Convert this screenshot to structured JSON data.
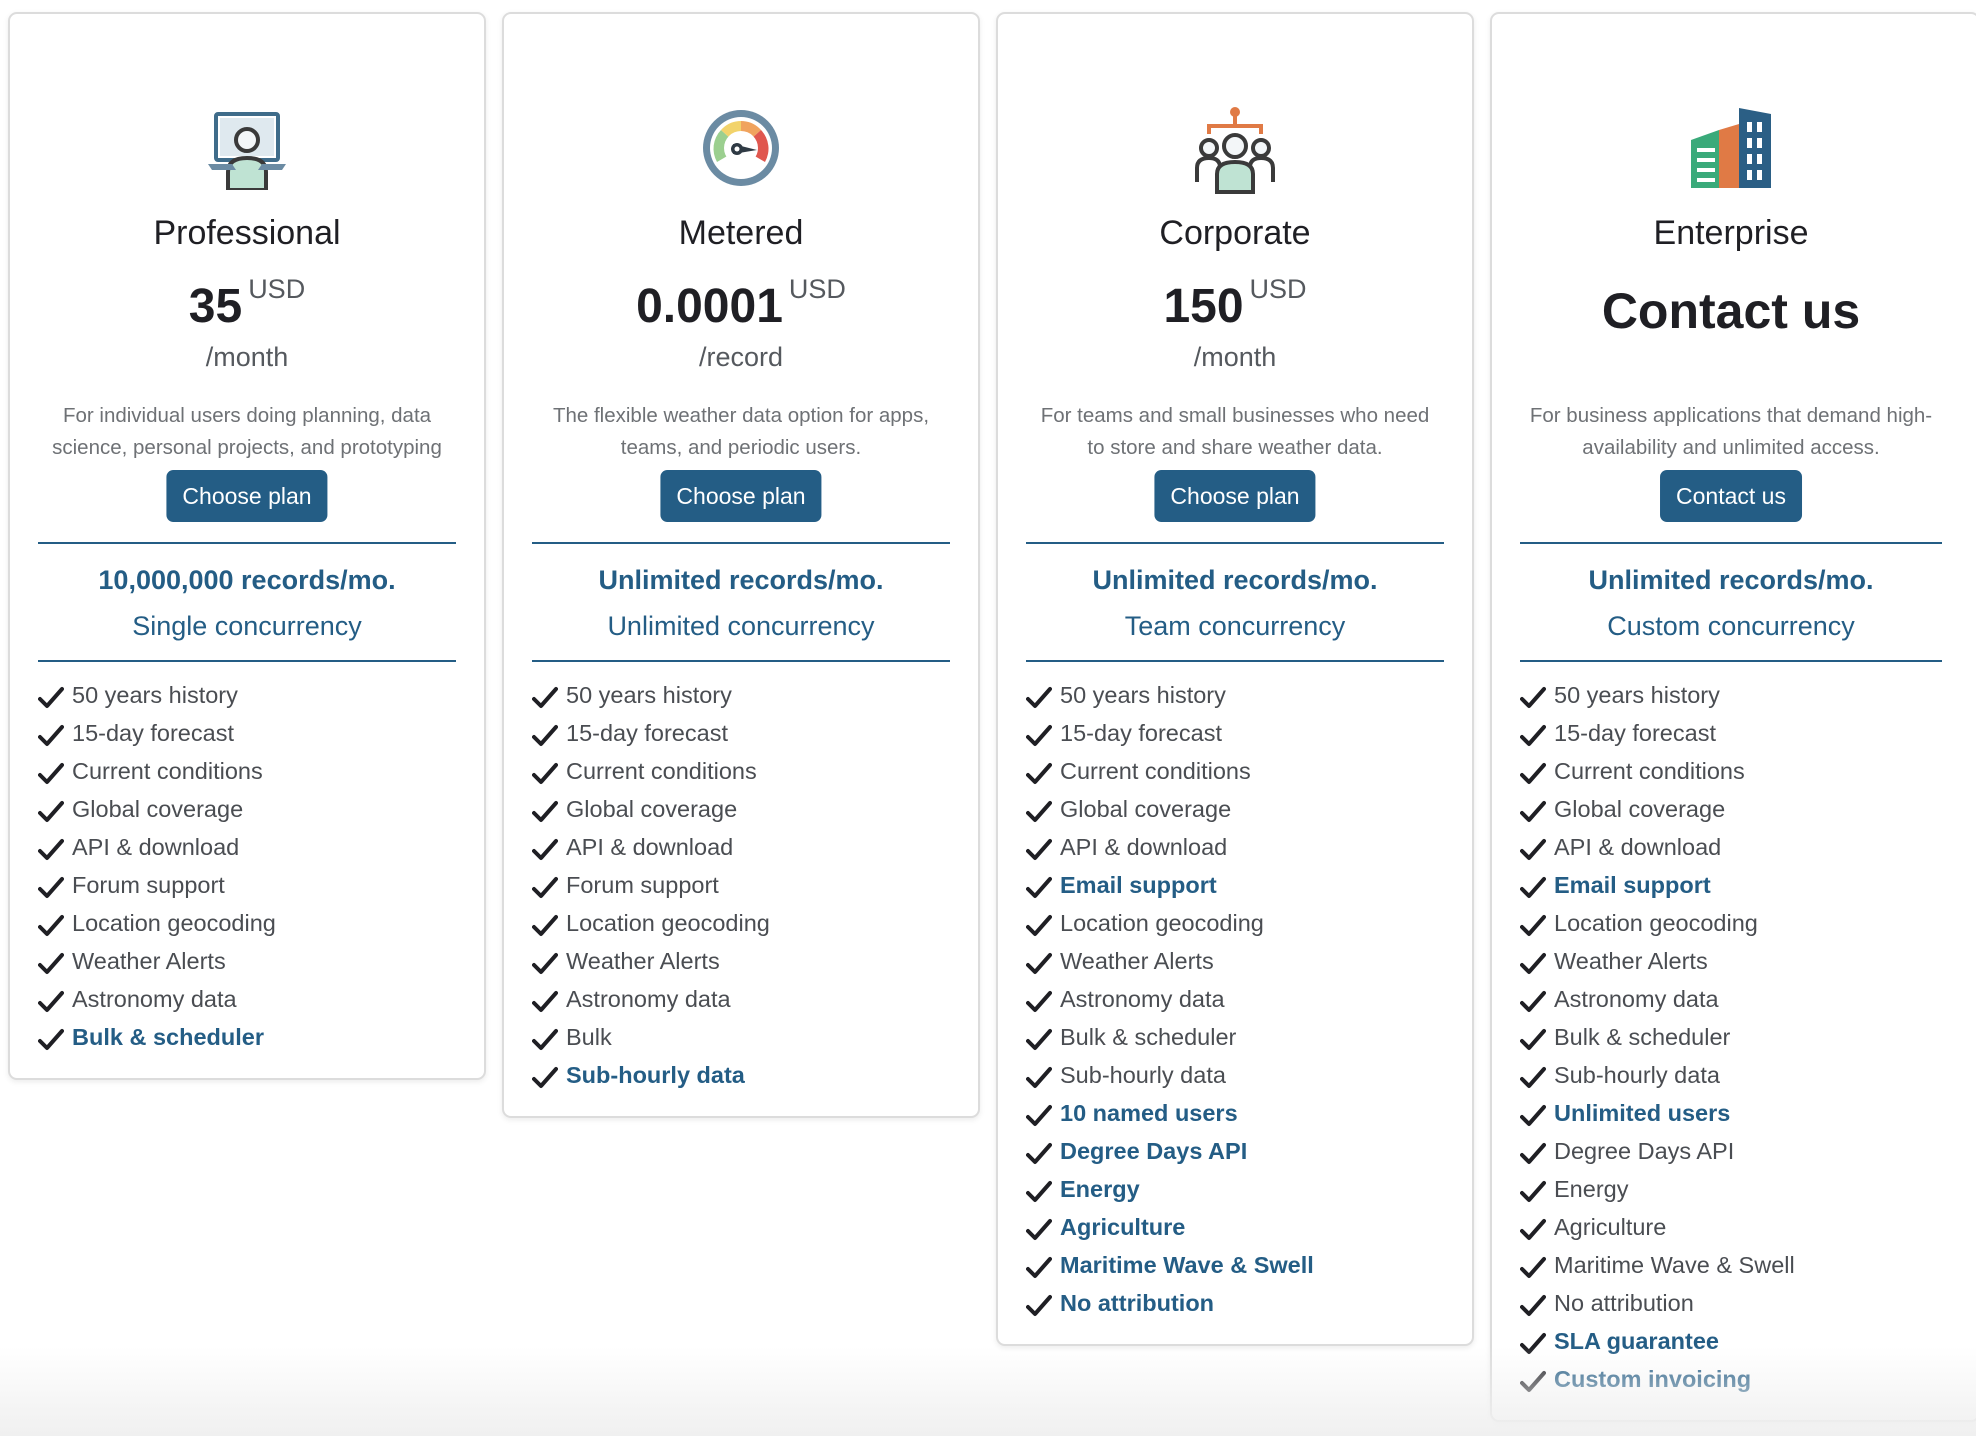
{
  "colors": {
    "accent": "#245d85",
    "text_dark": "#1f1f24",
    "text_muted": "#6e7175",
    "card_border": "#dcdcdc"
  },
  "plans": [
    {
      "icon": "laptop-user-icon",
      "name": "Professional",
      "price": "35",
      "currency": "USD",
      "period": "/month",
      "description": "For individual users doing planning, data science, personal projects, and prototyping",
      "button": "Choose plan",
      "records": "10,000,000 records/mo.",
      "concurrency": "Single concurrency",
      "features": [
        {
          "text": "50 years history",
          "highlight": false
        },
        {
          "text": "15-day forecast",
          "highlight": false
        },
        {
          "text": "Current conditions",
          "highlight": false
        },
        {
          "text": "Global coverage",
          "highlight": false
        },
        {
          "text": "API & download",
          "highlight": false
        },
        {
          "text": "Forum support",
          "highlight": false
        },
        {
          "text": "Location geocoding",
          "highlight": false
        },
        {
          "text": "Weather Alerts",
          "highlight": false
        },
        {
          "text": "Astronomy data",
          "highlight": false
        },
        {
          "text": "Bulk & scheduler",
          "highlight": true
        }
      ]
    },
    {
      "icon": "speedometer-gauge-icon",
      "name": "Metered",
      "price": "0.0001",
      "currency": "USD",
      "period": "/record",
      "description": "The flexible weather data option for apps, teams, and periodic users.",
      "button": "Choose plan",
      "records": "Unlimited records/mo.",
      "concurrency": "Unlimited concurrency",
      "features": [
        {
          "text": "50 years history",
          "highlight": false
        },
        {
          "text": "15-day forecast",
          "highlight": false
        },
        {
          "text": "Current conditions",
          "highlight": false
        },
        {
          "text": "Global coverage",
          "highlight": false
        },
        {
          "text": "API & download",
          "highlight": false
        },
        {
          "text": "Forum support",
          "highlight": false
        },
        {
          "text": "Location geocoding",
          "highlight": false
        },
        {
          "text": "Weather Alerts",
          "highlight": false
        },
        {
          "text": "Astronomy data",
          "highlight": false
        },
        {
          "text": "Bulk",
          "highlight": false
        },
        {
          "text": "Sub-hourly data",
          "highlight": true
        }
      ]
    },
    {
      "icon": "team-hierarchy-icon",
      "name": "Corporate",
      "price": "150",
      "currency": "USD",
      "period": "/month",
      "description": "For teams and small businesses who need to store and share weather data.",
      "button": "Choose plan",
      "records": "Unlimited records/mo.",
      "concurrency": "Team concurrency",
      "features": [
        {
          "text": "50 years history",
          "highlight": false
        },
        {
          "text": "15-day forecast",
          "highlight": false
        },
        {
          "text": "Current conditions",
          "highlight": false
        },
        {
          "text": "Global coverage",
          "highlight": false
        },
        {
          "text": "API & download",
          "highlight": false
        },
        {
          "text": "Email support",
          "highlight": true
        },
        {
          "text": "Location geocoding",
          "highlight": false
        },
        {
          "text": "Weather Alerts",
          "highlight": false
        },
        {
          "text": "Astronomy data",
          "highlight": false
        },
        {
          "text": "Bulk & scheduler",
          "highlight": false
        },
        {
          "text": "Sub-hourly data",
          "highlight": false
        },
        {
          "text": "10 named users",
          "highlight": true
        },
        {
          "text": "Degree Days API",
          "highlight": true
        },
        {
          "text": "Energy",
          "highlight": true
        },
        {
          "text": "Agriculture",
          "highlight": true
        },
        {
          "text": "Maritime Wave & Swell",
          "highlight": true
        },
        {
          "text": "No attribution",
          "highlight": true
        }
      ]
    },
    {
      "icon": "office-buildings-icon",
      "name": "Enterprise",
      "price": "Contact us",
      "currency": "",
      "period": "",
      "description": "For business applications that demand high-availability and unlimited access.",
      "button": "Contact us",
      "records": "Unlimited records/mo.",
      "concurrency": "Custom concurrency",
      "features": [
        {
          "text": "50 years history",
          "highlight": false
        },
        {
          "text": "15-day forecast",
          "highlight": false
        },
        {
          "text": "Current conditions",
          "highlight": false
        },
        {
          "text": "Global coverage",
          "highlight": false
        },
        {
          "text": "API & download",
          "highlight": false
        },
        {
          "text": "Email support",
          "highlight": true
        },
        {
          "text": "Location geocoding",
          "highlight": false
        },
        {
          "text": "Weather Alerts",
          "highlight": false
        },
        {
          "text": "Astronomy data",
          "highlight": false
        },
        {
          "text": "Bulk & scheduler",
          "highlight": false
        },
        {
          "text": "Sub-hourly data",
          "highlight": false
        },
        {
          "text": "Unlimited users",
          "highlight": true
        },
        {
          "text": "Degree Days API",
          "highlight": false
        },
        {
          "text": "Energy",
          "highlight": false
        },
        {
          "text": "Agriculture",
          "highlight": false
        },
        {
          "text": "Maritime Wave & Swell",
          "highlight": false
        },
        {
          "text": "No attribution",
          "highlight": false
        },
        {
          "text": "SLA guarantee",
          "highlight": true
        },
        {
          "text": "Custom invoicing",
          "highlight": true
        }
      ]
    }
  ]
}
